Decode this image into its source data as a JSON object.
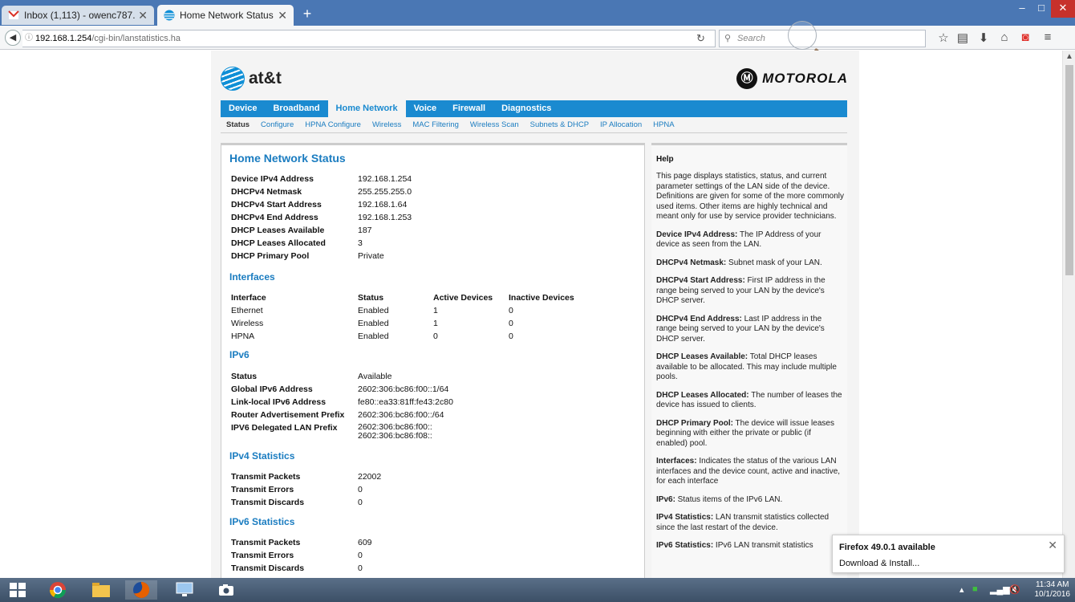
{
  "browser": {
    "tabs": [
      {
        "label": "Inbox (1,113) - owenc787...",
        "icon": "gmail-icon"
      },
      {
        "label": "Home Network Status",
        "icon": "att-icon"
      }
    ],
    "new_tab": "+",
    "url_host": "192.168.1.254",
    "url_path": "/cgi-bin/lanstatistics.ha",
    "search_placeholder": "Search",
    "window_controls": [
      "–",
      "□",
      "✕"
    ]
  },
  "header": {
    "brand_left": "at&t",
    "brand_right": "MOTOROLA"
  },
  "main_nav": [
    "Device",
    "Broadband",
    "Home Network",
    "Voice",
    "Firewall",
    "Diagnostics"
  ],
  "main_nav_selected": "Home Network",
  "sub_nav": [
    "Status",
    "Configure",
    "HPNA Configure",
    "Wireless",
    "MAC Filtering",
    "Wireless Scan",
    "Subnets & DHCP",
    "IP Allocation",
    "HPNA"
  ],
  "sub_nav_selected": "Status",
  "status": {
    "title": "Home Network Status",
    "rows": [
      {
        "k": "Device IPv4 Address",
        "v": "192.168.1.254"
      },
      {
        "k": "DHCPv4 Netmask",
        "v": "255.255.255.0"
      },
      {
        "k": "DHCPv4 Start Address",
        "v": "192.168.1.64"
      },
      {
        "k": "DHCPv4 End Address",
        "v": "192.168.1.253"
      },
      {
        "k": "DHCP Leases Available",
        "v": "187"
      },
      {
        "k": "DHCP Leases Allocated",
        "v": "3"
      },
      {
        "k": "DHCP Primary Pool",
        "v": "Private"
      }
    ]
  },
  "interfaces": {
    "title": "Interfaces",
    "headers": [
      "Interface",
      "Status",
      "Active Devices",
      "Inactive Devices"
    ],
    "rows": [
      [
        "Ethernet",
        "Enabled",
        "1",
        "0"
      ],
      [
        "Wireless",
        "Enabled",
        "1",
        "0"
      ],
      [
        "HPNA",
        "Enabled",
        "0",
        "0"
      ]
    ]
  },
  "ipv6": {
    "title": "IPv6",
    "rows": [
      {
        "k": "Status",
        "v": "Available"
      },
      {
        "k": "Global IPv6 Address",
        "v": "2602:306:bc86:f00::1/64"
      },
      {
        "k": "Link-local IPv6 Address",
        "v": "fe80::ea33:81ff:fe43:2c80"
      },
      {
        "k": "Router Advertisement Prefix",
        "v": "2602:306:bc86:f00::/64"
      },
      {
        "k": "IPV6 Delegated LAN Prefix",
        "v": "2602:306:bc86:f00::",
        "v2": "2602:306:bc86:f08::"
      }
    ]
  },
  "ipv4_stats": {
    "title": "IPv4 Statistics",
    "rows": [
      {
        "k": "Transmit Packets",
        "v": "22002"
      },
      {
        "k": "Transmit Errors",
        "v": "0"
      },
      {
        "k": "Transmit Discards",
        "v": "0"
      }
    ]
  },
  "ipv6_stats": {
    "title": "IPv6 Statistics",
    "rows": [
      {
        "k": "Transmit Packets",
        "v": "609"
      },
      {
        "k": "Transmit Errors",
        "v": "0"
      },
      {
        "k": "Transmit Discards",
        "v": "0"
      }
    ]
  },
  "help": {
    "title": "Help",
    "intro": "This page displays statistics, status, and current parameter settings of the LAN side of the device. Definitions are given for some of the more commonly used items. Other items are highly technical and meant only for use by service provider technicians.",
    "items": [
      {
        "term": "Device IPv4 Address:",
        "text": " The IP Address of your device as seen from the LAN."
      },
      {
        "term": "DHCPv4 Netmask:",
        "text": " Subnet mask of your LAN."
      },
      {
        "term": "DHCPv4 Start Address:",
        "text": " First IP address in the range being served to your LAN by the device's DHCP server."
      },
      {
        "term": "DHCPv4 End Address:",
        "text": " Last IP address in the range being served to your LAN by the device's DHCP server."
      },
      {
        "term": "DHCP Leases Available:",
        "text": " Total DHCP leases available to be allocated. This may include multiple pools."
      },
      {
        "term": "DHCP Leases Allocated:",
        "text": " The number of leases the device has issued to clients."
      },
      {
        "term": "DHCP Primary Pool:",
        "text": " The device will issue leases beginning with either the private or public (if enabled) pool."
      },
      {
        "term": "Interfaces:",
        "text": " Indicates the status of the various LAN interfaces and the device count, active and inactive, for each interface"
      },
      {
        "term": "IPv6:",
        "text": " Status items of the IPv6 LAN."
      },
      {
        "term": "IPv4 Statistics:",
        "text": " LAN transmit statistics collected since the last restart of the device."
      },
      {
        "term": "IPv6 Statistics:",
        "text": " IPv6 LAN transmit statistics"
      }
    ]
  },
  "notification": {
    "title": "Firefox 49.0.1 available",
    "link": "Download & Install...",
    "close": "✕"
  },
  "taskbar": {
    "time": "11:34 AM",
    "date": "10/1/2016"
  }
}
